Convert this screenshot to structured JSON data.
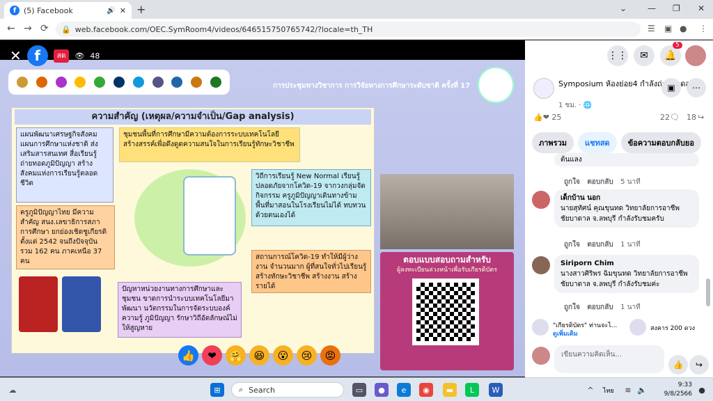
{
  "tab": {
    "title": "(5) Facebook"
  },
  "url": "web.facebook.com/OEC.SymRoom4/videos/646515750765742/?locale=th_TH",
  "video": {
    "live_label": "สด",
    "viewers": "48",
    "conference_title": "การประชุมทางวิชาการ การวิจัยทางการศึกษาระดับชาติ ครั้งที่ 17",
    "slide_title": "ความสำคัญ (เหตุผล/ความจำเป็น/Gap analysis)",
    "boxes": [
      "แผนพัฒนาเศรษฐกิจสังคม แผนการศึกษาแห่งชาติ ส่งเสริมสารสนเทศ สื่อเรียนรู้ ถ่ายทอดภูมิปัญญา สร้างสังคมแห่งการเรียนรู้ตลอดชีวิต",
      "ชุมชนพื้นที่การศึกษามีความต้องการระบบเทคโนโลยี สร้างสรรค์เพื่อดึงดูดความสนใจในการเรียนรู้ทักษะวิชาชีพ",
      "วิถีการเรียนรู้ New Normal เรียนรู้ปลอดภัยจากโควิด-19 จากวงกลุ่มจัดกิจกรรม ครูภูมิปัญญาเดินทางข้ามพื้นที่มาสอนในโรงเรียนไม่ได้ ทบทวนด้วยตนเองได้",
      "ครูภูมิปัญญาไทย มีความสำคัญ สนง.เลขาธิการสภาการศึกษา ยกย่องเชิดชูเกียรติ ตั้งแต่ 2542 จนถึงปัจจุบัน รวม 162 คน ภาคเหนือ 37 คน",
      "สถานการณ์โควิด-19 ทำให้มีผู้ว่างงาน จำนวนมาก ผู้ที่สนใจทั่วไปเรียนรู้สร้างทักษะวิชาชีพ สร้างงาน สร้างรายได้",
      "ปัญหาหน่วยงานทางการศึกษาและชุมชน ขาดการนำระบบเทคโนโลยีมาพัฒนา นวัตกรรมในการจัดระบบองค์ความรู้ ภูมิปัญญา รักษาวิถีอัตลักษณ์ไม่ให้สูญหาย"
    ],
    "qr_title": "ตอบแบบสอบถามสำหรับ",
    "qr_subtitle": "ผู้ลงทะเบียนล่วงหน้าเพื่อรับเกียรติบัตร"
  },
  "panel": {
    "notif_count": "5",
    "page_name": "Symposium ห้องย่อย4 กำลังถ่ายทอดสด",
    "time": "1 ชม. · 🌐",
    "reactions_count": "25",
    "comments_count": "22",
    "shares_count": "18",
    "tabs": [
      "ภาพรวม",
      "แชทสด",
      "ข้อความตอบกลับยอ"
    ],
    "comments": [
      {
        "name": "",
        "text": "ต้นแลง",
        "like": "ถูกใจ",
        "reply": "ตอบกลับ",
        "time": "5 นาที"
      },
      {
        "name": "เด็กบ้าน นอก",
        "text": "นายสุทัศน์ คุณขุนทด วิทยาลัยการอาชีพชัยบาดาล จ.ลพบุรี กำลังรับชมครับ",
        "like": "ถูกใจ",
        "reply": "ตอบกลับ",
        "time": "1 นาที"
      },
      {
        "name": "Siriporn Chim",
        "text": "นางสาวศิริพร ฉิมขุนทด วิทยาลัยการอาชีพชัยบาดาล จ.ลพบุรี กำลังรับชมค่ะ",
        "like": "ถูกใจ",
        "reply": "ตอบกลับ",
        "time": "1 นาที"
      }
    ],
    "pinned1": "\"เกียรติบัตร\" ท่านจะไ...",
    "pinned1_more": "ดูเพิ่มเติม",
    "pinned2": "สงคาร 200 ดวง",
    "comment_placeholder": "เขียนความคิดเห็น..."
  },
  "taskbar": {
    "search": "Search",
    "lang": "ไทย",
    "time": "9:33",
    "date": "9/8/2566"
  }
}
